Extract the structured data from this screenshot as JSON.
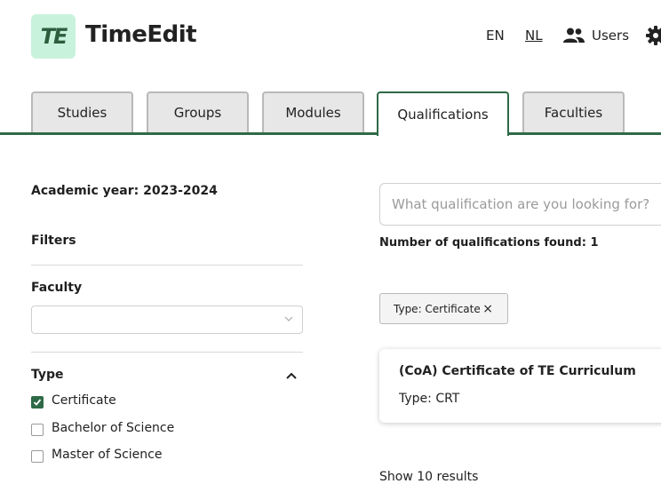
{
  "header": {
    "logo_text": "TE",
    "brand": "TimeEdit",
    "lang_en": "EN",
    "lang_nl": "NL",
    "users_label": "Users"
  },
  "tabs": [
    {
      "label": "Studies"
    },
    {
      "label": "Groups"
    },
    {
      "label": "Modules"
    },
    {
      "label": "Qualifications",
      "active": true
    },
    {
      "label": "Faculties"
    }
  ],
  "left": {
    "academic_year": "Academic year: 2023-2024",
    "filters_label": "Filters",
    "faculty_label": "Faculty",
    "faculty_value": "",
    "type_label": "Type",
    "type_options": [
      {
        "label": "Certificate",
        "checked": true
      },
      {
        "label": "Bachelor of Science",
        "checked": false
      },
      {
        "label": "Master of Science",
        "checked": false
      }
    ]
  },
  "right": {
    "search_placeholder": "What qualification are you looking for?",
    "found_text": "Number of qualifications found: 1",
    "chip_label": "Type: Certificate",
    "chip_close": "×",
    "result": {
      "title": "(CoA) Certificate of TE Curriculum",
      "type": "Type: CRT"
    },
    "show_more": "Show 10 results"
  },
  "colors": {
    "accent": "#2e6a47",
    "logo_bg": "#c8f2dc",
    "tab_bg": "#e7e7e7"
  }
}
